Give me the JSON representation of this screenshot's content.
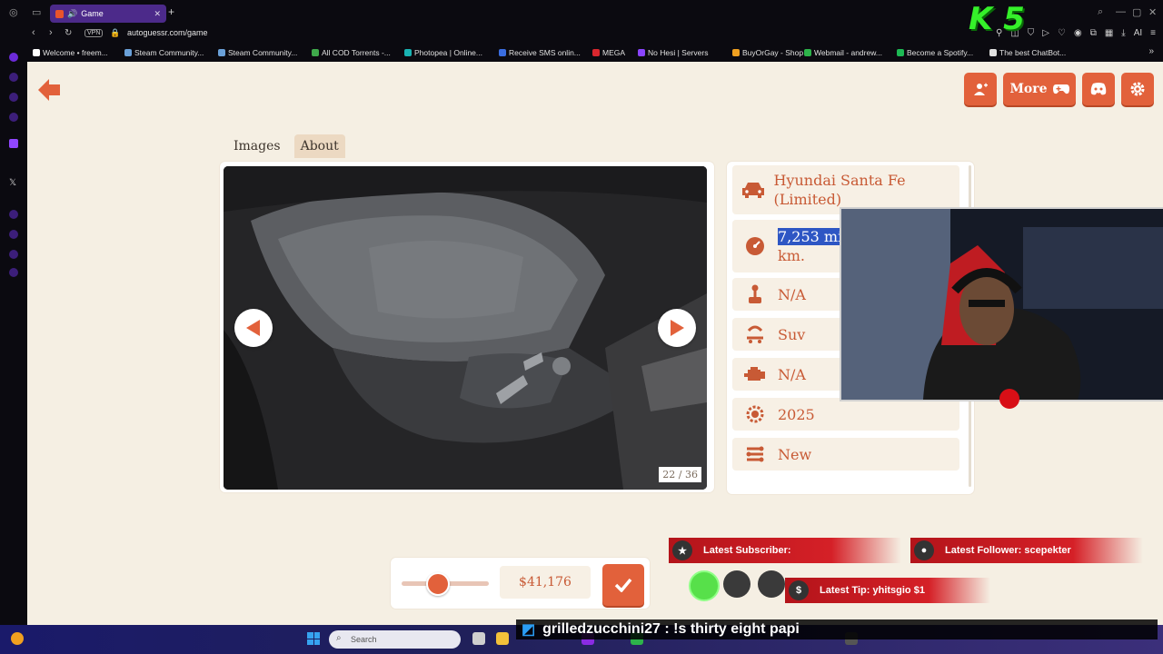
{
  "browser": {
    "tab_title": "Game",
    "new_tab": "+",
    "url": "autoguessr.com/game",
    "vpn_label": "VPN",
    "bookmarks": [
      {
        "label": "Welcome • freem...",
        "color": "#ffffff"
      },
      {
        "label": "Steam Community...",
        "color": "#6aa0d8"
      },
      {
        "label": "Steam Community...",
        "color": "#6aa0d8"
      },
      {
        "label": "All COD Torrents -...",
        "color": "#3fa94b"
      },
      {
        "label": "Photopea | Online...",
        "color": "#19b3b3"
      },
      {
        "label": "Receive SMS onlin...",
        "color": "#3a6de0"
      },
      {
        "label": "MEGA",
        "color": "#d9272e"
      },
      {
        "label": "No Hesi | Servers",
        "color": "#8a44ff"
      },
      {
        "label": "BuyOrGay - Shop",
        "color": "#f0a020"
      },
      {
        "label": "Webmail - andrew...",
        "color": "#2db34a"
      },
      {
        "label": "Become a Spotify...",
        "color": "#1db954"
      },
      {
        "label": "The best ChatBot...",
        "color": "#e0e0e0"
      }
    ],
    "overlay_logo": "K 5",
    "toolbar_ai": "AI"
  },
  "header": {
    "more_label": "More"
  },
  "tabs": {
    "images": "Images",
    "about": "About"
  },
  "gallery": {
    "counter": "22 / 36"
  },
  "car": {
    "model": "Hyundai Santa Fe (Limited)",
    "mileage_value": "7,253 mi",
    "mileage_unit": "km.",
    "transmission": "N/A",
    "body": "Suv",
    "engine": "N/A",
    "year": "2025",
    "condition": "New"
  },
  "guess": {
    "price": "$41,176",
    "slider_fraction": 0.42
  },
  "overlay": {
    "latest_subscriber": "Latest Subscriber:",
    "latest_follower_label": "Latest Follower:",
    "latest_follower_name": "scepekter",
    "latest_tip_label": "Latest Tip:",
    "latest_tip_value": "yhitsgio $1",
    "chat_message": "grilledzucchini27 : !s thirty eight papi"
  },
  "taskbar": {
    "search_placeholder": "Search"
  },
  "colors": {
    "accent": "#e2613b",
    "value_text": "#c85a35",
    "tab_active": "#4c2a8a",
    "highlight": "#2e56c4"
  }
}
